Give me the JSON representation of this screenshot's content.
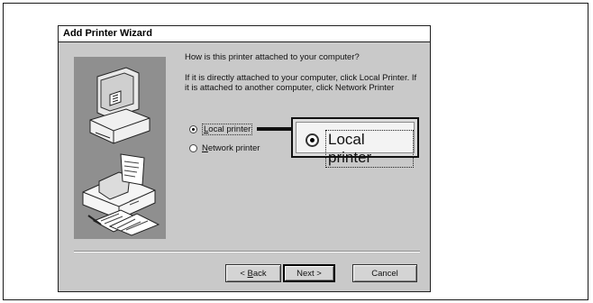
{
  "dialog": {
    "title": "Add Printer Wizard",
    "question": "How is this printer attached to your computer?",
    "instructions": "If it is directly attached to your computer, click Local Printer. If it is attached to another computer, click Network Printer",
    "options": [
      {
        "pre": "",
        "accel": "L",
        "post": "ocal printer",
        "checked": true
      },
      {
        "pre": "",
        "accel": "N",
        "post": "etwork printer",
        "checked": false
      }
    ],
    "callout": {
      "label": "Local printer"
    },
    "buttons": {
      "back": {
        "pre": "< ",
        "accel": "B",
        "post": "ack"
      },
      "next": "Next >",
      "cancel": "Cancel"
    }
  }
}
